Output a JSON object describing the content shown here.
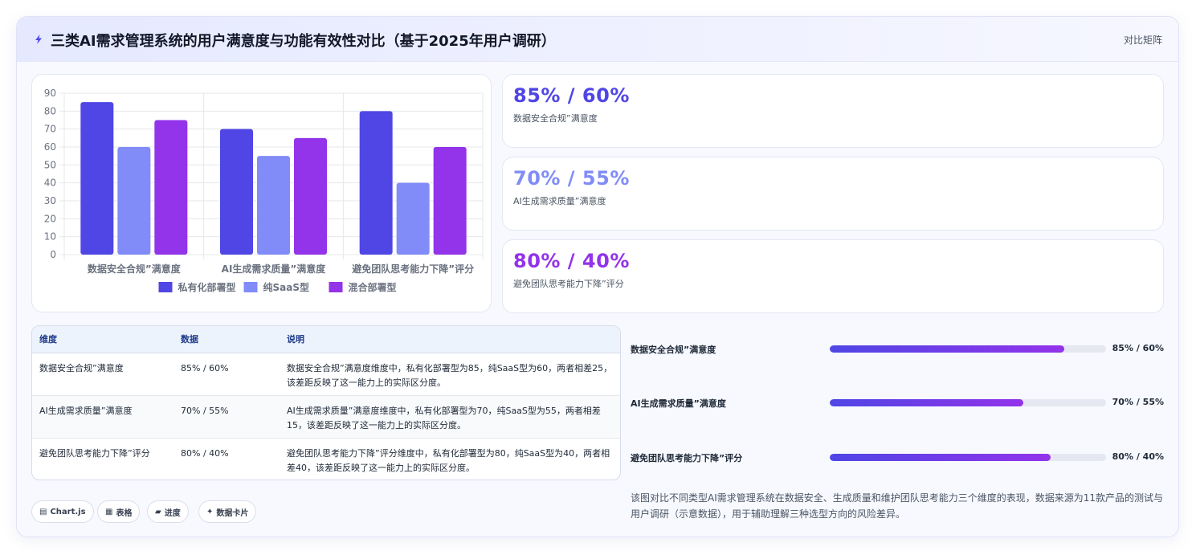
{
  "header": {
    "title": "三类AI需求管理系统的用户满意度与功能有效性对比（基于2025年用户调研）",
    "right_label": "对比矩阵",
    "icon": "lightning-icon"
  },
  "colors": {
    "private": "#4f46e5",
    "saas": "#818cf8",
    "hybrid": "#9333ea"
  },
  "chart_data": {
    "type": "bar",
    "categories": [
      "数据安全合规”满意度",
      "AI生成需求质量”满意度",
      "避免团队思考能力下降”评分"
    ],
    "series": [
      {
        "name": "私有化部署型",
        "values": [
          85,
          70,
          80
        ]
      },
      {
        "name": "纯SaaS型",
        "values": [
          60,
          55,
          40
        ]
      },
      {
        "name": "混合部署型",
        "values": [
          75,
          65,
          60
        ]
      }
    ],
    "ylim": [
      0,
      90
    ],
    "yticks": [
      0,
      10,
      20,
      30,
      40,
      50,
      60,
      70,
      80,
      90
    ],
    "grid": true,
    "legend": "bottom"
  },
  "stats": [
    {
      "value": "85% / 60%",
      "label": "数据安全合规”满意度"
    },
    {
      "value": "70% / 55%",
      "label": "AI生成需求质量”满意度"
    },
    {
      "value": "80% / 40%",
      "label": "避免团队思考能力下降”评分"
    }
  ],
  "table": {
    "headers": [
      "维度",
      "数据",
      "说明"
    ],
    "rows": [
      {
        "dim": "数据安全合规”满意度",
        "data": "85% / 60%",
        "desc": "数据安全合规”满意度维度中，私有化部署型为85，纯SaaS型为60，两者相差25，该差距反映了这一能力上的实际区分度。"
      },
      {
        "dim": "AI生成需求质量”满意度",
        "data": "70% / 55%",
        "desc": "AI生成需求质量”满意度维度中，私有化部署型为70，纯SaaS型为55，两者相差15，该差距反映了这一能力上的实际区分度。"
      },
      {
        "dim": "避免团队思考能力下降”评分",
        "data": "80% / 40%",
        "desc": "避免团队思考能力下降”评分维度中，私有化部署型为80，纯SaaS型为40，两者相差40，该差距反映了这一能力上的实际区分度。"
      }
    ]
  },
  "chips": [
    {
      "icon": "chart-icon",
      "label": "Chart.js"
    },
    {
      "icon": "table-icon",
      "label": "表格"
    },
    {
      "icon": "folder-icon",
      "label": "进度"
    },
    {
      "icon": "sparkle-icon",
      "label": "数据卡片"
    }
  ],
  "progress": [
    {
      "label": "数据安全合规”满意度",
      "percent": 85,
      "value": "85% / 60%"
    },
    {
      "label": "AI生成需求质量”满意度",
      "percent": 70,
      "value": "70% / 55%"
    },
    {
      "label": "避免团队思考能力下降”评分",
      "percent": 80,
      "value": "80% / 40%"
    }
  ],
  "note": "该图对比不同类型AI需求管理系统在数据安全、生成质量和维护团队思考能力三个维度的表现，数据来源为11款产品的测试与用户调研（示意数据），用于辅助理解三种选型方向的风险差异。"
}
